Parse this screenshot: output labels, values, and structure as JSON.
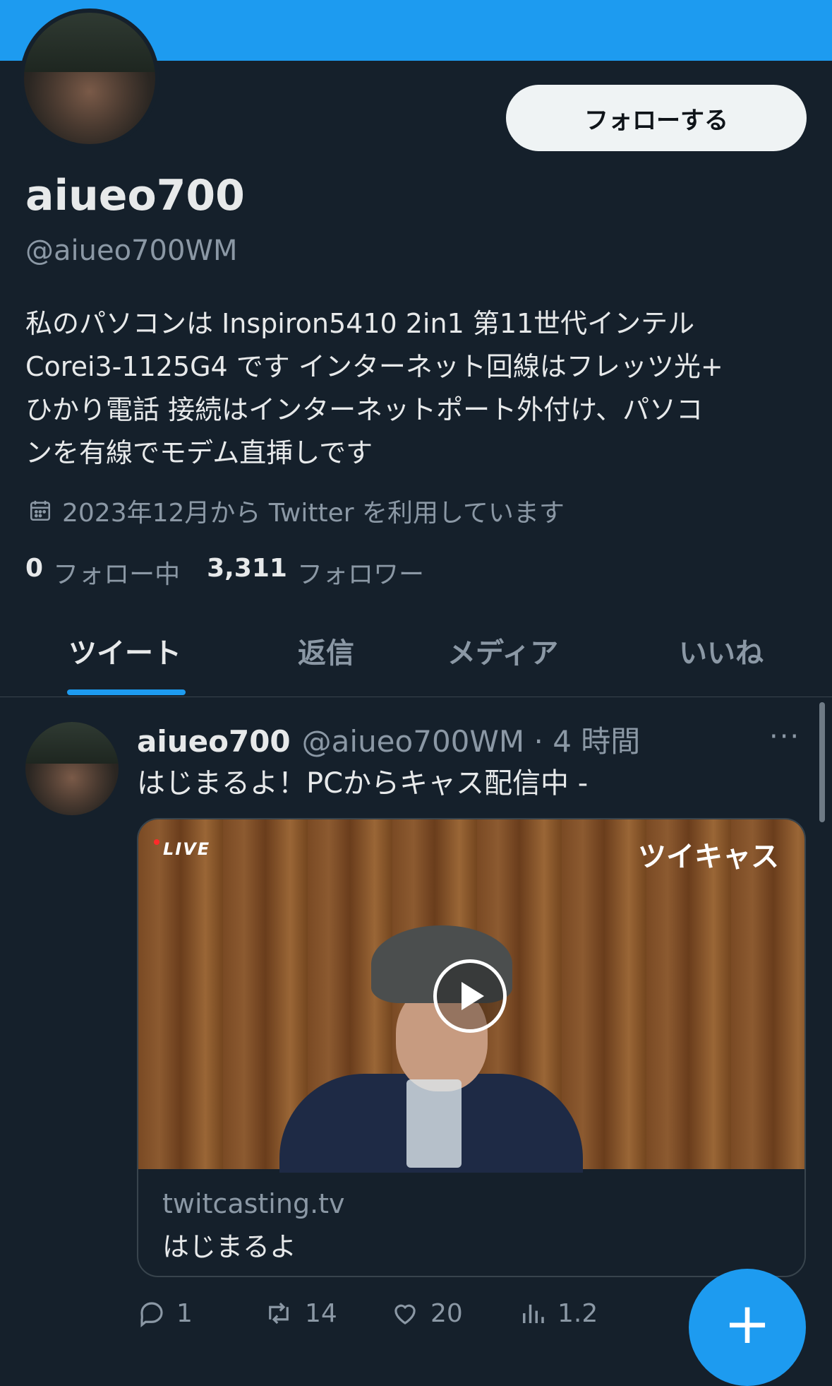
{
  "profile": {
    "follow_label": "フォローする",
    "name": "aiueo700",
    "handle": "@aiueo700WM",
    "bio": "私のパソコンは Inspiron5410 2in1 第11世代インテル\n Corei3-1125G4 です インターネット回線はフレッツ光+\nひかり電話 接続はインターネットポート外付け、パソコ\nンを有線でモデム直挿しです",
    "joined": "2023年12月から Twitter を利用しています",
    "following_count": "0",
    "following_label": "フォロー中",
    "followers_count": "3,311",
    "followers_label": "フォロワー"
  },
  "tabs": {
    "tweets": "ツイート",
    "replies": "返信",
    "media": "メディア",
    "likes": "いいね"
  },
  "tweet": {
    "name": "aiueo700",
    "handle_time": "@aiueo700WM · 4 時間",
    "more": "···",
    "text": "はじまるよ！PCからキャス配信中 -",
    "card": {
      "live_label": "LIVE",
      "brand": "ツイキャス",
      "domain": "twitcasting.tv",
      "title": "はじまるよ"
    },
    "actions": {
      "replies": "1",
      "retweets": "14",
      "likes": "20",
      "views": "1.2"
    }
  },
  "fab_label": "+",
  "colors": {
    "background": "#15202b",
    "accent": "#1d9bf0",
    "secondary_text": "#8b98a5"
  }
}
